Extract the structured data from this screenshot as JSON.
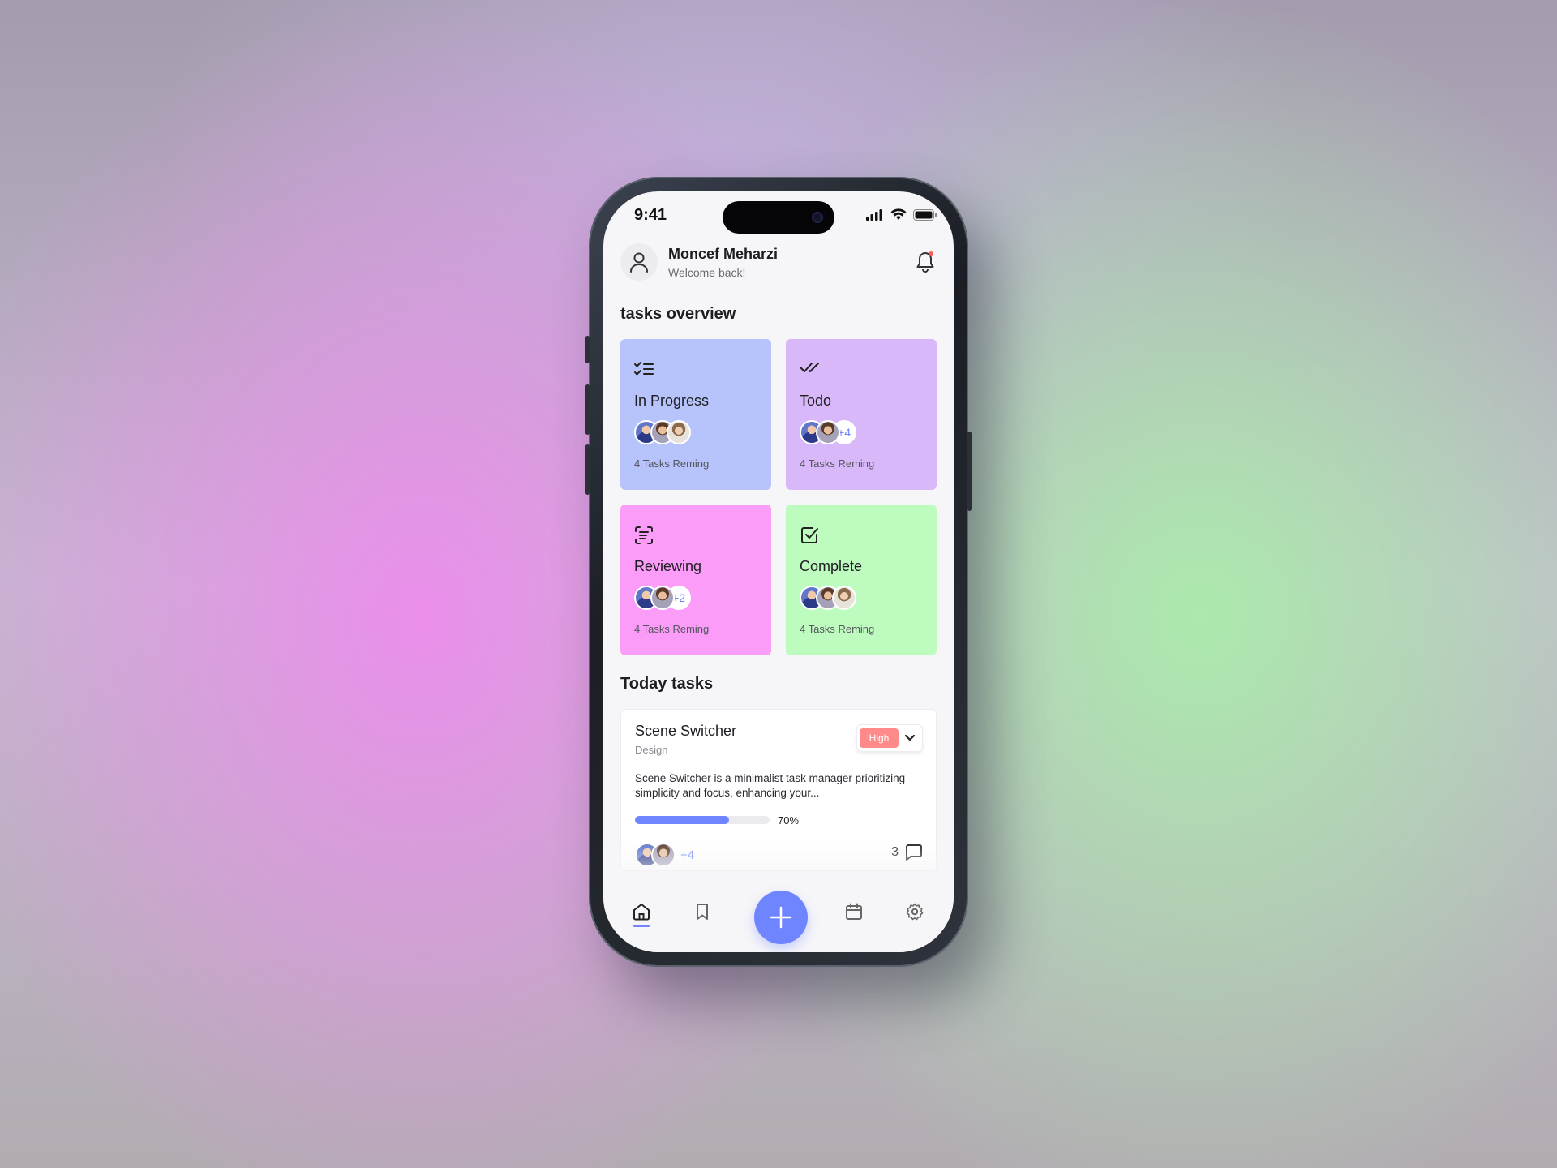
{
  "status_bar": {
    "time": "9:41"
  },
  "user": {
    "name": "Moncef Meharzi",
    "greeting": "Welcome back!"
  },
  "overview": {
    "title": "tasks overview",
    "cards": [
      {
        "title": "In Progress",
        "remaining": "4 Tasks Reming",
        "extra": "",
        "color": "#b7c4fb",
        "icon": "list-check-icon"
      },
      {
        "title": "Todo",
        "remaining": "4 Tasks Reming",
        "extra": "+4",
        "color": "#d8b8f8",
        "icon": "double-check-icon"
      },
      {
        "title": "Reviewing",
        "remaining": "4 Tasks Reming",
        "extra": "+2",
        "color": "#fb9cf8",
        "icon": "scan-text-icon"
      },
      {
        "title": "Complete",
        "remaining": "4 Tasks Reming",
        "extra": "",
        "color": "#bdfbbf",
        "icon": "checkbox-icon"
      }
    ]
  },
  "today": {
    "title": "Today tasks",
    "task": {
      "title": "Scene Switcher",
      "category": "Design",
      "priority": "High",
      "description": "Scene Switcher is a minimalist task manager prioritizing simplicity and focus, enhancing your...",
      "progress": 70,
      "progress_label": "70%",
      "extra_members": "+4",
      "comments": "3"
    }
  },
  "nav": {
    "items": [
      "home-icon",
      "bookmark-icon",
      "add-icon",
      "calendar-icon",
      "settings-icon"
    ],
    "active": "home-icon"
  },
  "colors": {
    "accent": "#6f84ff",
    "priority_high": "#ff8a8a"
  }
}
